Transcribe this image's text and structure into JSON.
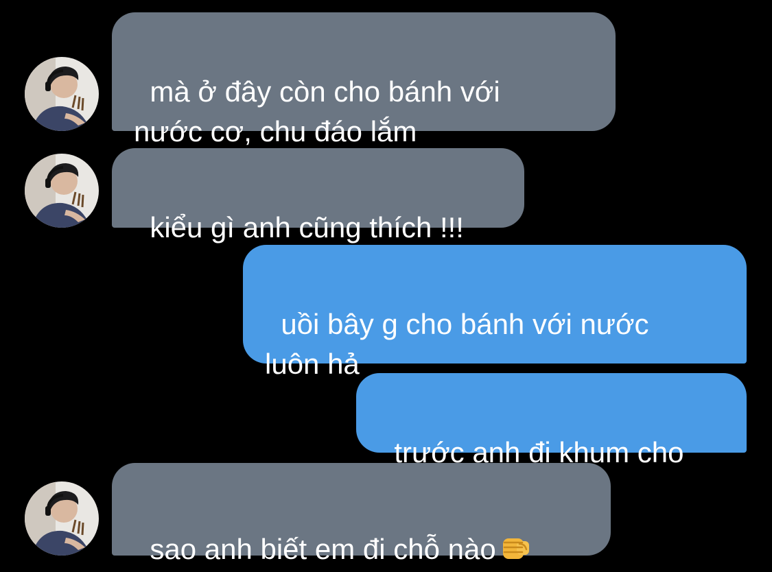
{
  "theme": {
    "background": "#000000",
    "incoming_bubble": "#6b7683",
    "outgoing_bubble": "#4a9be6",
    "text": "#ffffff"
  },
  "messages": [
    {
      "direction": "incoming",
      "text": "mà ở đây còn cho bánh với\nnước cơ, chu đáo lắm"
    },
    {
      "direction": "incoming",
      "text": "kiểu gì anh cũng thích !!!"
    },
    {
      "direction": "outgoing",
      "text": "uồi bây g cho bánh với nước\nluôn hả"
    },
    {
      "direction": "outgoing",
      "text": "trước anh đi khum cho"
    },
    {
      "direction": "incoming",
      "text": "sao anh biết em đi chỗ nào",
      "emoji": "oncoming-fist-icon"
    }
  ]
}
